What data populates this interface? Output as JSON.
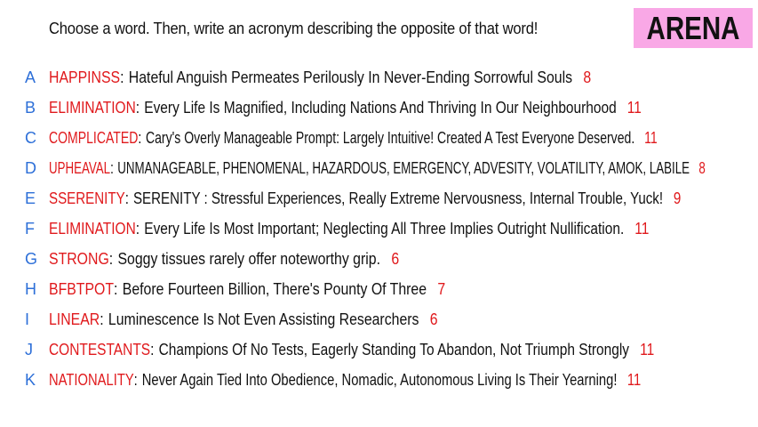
{
  "prompt": "Choose a word. Then, write an acronym describing the opposite of that word!",
  "badge": {
    "label": "ARENA",
    "bg_color": "#f9a8e6"
  },
  "colors": {
    "letter": "#2d6fd8",
    "word": "#e0191c",
    "score": "#e0191c",
    "text": "#111111"
  },
  "entries": [
    {
      "letter": "A",
      "word": "HAPPINSS",
      "acronym": "Hateful Anguish Permeates Perilously In Never-Ending Sorrowful Souls",
      "score": "8"
    },
    {
      "letter": "B",
      "word": "ELIMINATION",
      "acronym": "Every Life Is Magnified, Including Nations And Thriving In Our Neighbourhood",
      "score": "11"
    },
    {
      "letter": "C",
      "word": "COMPLICATED",
      "acronym": "Cary's Overly Manageable Prompt: Largely Intuitive! Created A Test Everyone Deserved.",
      "score": "11"
    },
    {
      "letter": "D",
      "word": "UPHEAVAL",
      "acronym": "UNMANAGEABLE, PHENOMENAL, HAZARDOUS, EMERGENCY, ADVESITY, VOLATILITY, AMOK, LABILE",
      "score": "8"
    },
    {
      "letter": "E",
      "word": "SSERENITY",
      "acronym": "SERENITY : Stressful Experiences, Really Extreme Nervousness, Internal Trouble, Yuck!",
      "score": "9"
    },
    {
      "letter": "F",
      "word": "ELIMINATION",
      "acronym": "Every Life Is Most Important; Neglecting All Three Implies Outright Nullification.",
      "score": "11"
    },
    {
      "letter": "G",
      "word": "STRONG",
      "acronym": "Soggy tissues rarely offer noteworthy grip.",
      "score": "6"
    },
    {
      "letter": "H",
      "word": "BFBTPOT",
      "acronym": "Before Fourteen Billion, There's Pounty Of Three",
      "score": "7"
    },
    {
      "letter": "I",
      "word": "LINEAR",
      "acronym": "Luminescence Is Not Even Assisting Researchers",
      "score": "6"
    },
    {
      "letter": "J",
      "word": "CONTESTANTS",
      "acronym": "Champions Of No Tests, Eagerly Standing To Abandon, Not Triumph Strongly",
      "score": "11"
    },
    {
      "letter": "K",
      "word": "NATIONALITY",
      "acronym": "Never Again Tied Into Obedience, Nomadic, Autonomous Living Is Their Yearning!",
      "score": "11"
    }
  ]
}
